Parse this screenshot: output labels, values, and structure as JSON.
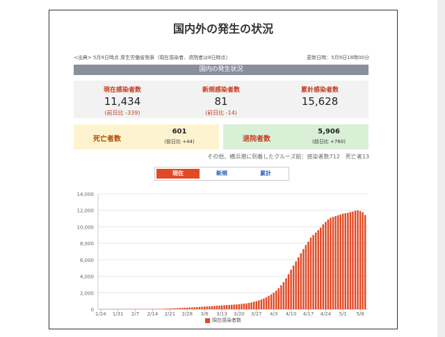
{
  "page": {
    "title": "国内外の発生の状況",
    "source": "<出典> 5月9日時点 厚生労働省発表（現在感染者、退院者は8日時点）",
    "updated": "更新日時：5月9日18時00分",
    "section_header": "国内の発生状況"
  },
  "summary": {
    "current": {
      "label": "現在感染者数",
      "value": "11,434",
      "diff": "(前日比 -339)"
    },
    "new": {
      "label": "新規感染者数",
      "value": "81",
      "diff": "(前日比 -14)"
    },
    "cumulative": {
      "label": "累計感染者数",
      "value": "15,628"
    },
    "deaths": {
      "label": "死亡者数",
      "value": "601",
      "diff": "(前日比 +44)"
    },
    "recovered": {
      "label": "退院者数",
      "value": "5,906",
      "diff": "(前日比 +760)"
    },
    "cruise_note": "その他、横浜港に到着したクルーズ船：感染者数712　死亡者13"
  },
  "tabs": [
    {
      "label": "現在",
      "active": true
    },
    {
      "label": "新規",
      "active": false
    },
    {
      "label": "累計",
      "active": false
    }
  ],
  "colors": {
    "accent": "#e24a26",
    "section_bar": "#8a8f9e",
    "deaths_bg": "#fdf4cf",
    "recovered_bg": "#d9f0d6"
  },
  "chart_data": {
    "type": "bar",
    "start_date": "2020-01-24",
    "x_ticks": [
      "1/24",
      "1/31",
      "2/7",
      "2/14",
      "2/21",
      "2/28",
      "3/6",
      "3/13",
      "3/20",
      "3/27",
      "4/3",
      "4/10",
      "4/17",
      "4/24",
      "5/1",
      "5/8"
    ],
    "ylim": [
      0,
      14000
    ],
    "y_ticks": [
      "0",
      "2,000",
      "4,000",
      "6,000",
      "8,000",
      "10,000",
      "12,000",
      "14,000"
    ],
    "grid": true,
    "legend": "bottom",
    "series": [
      {
        "name": "現在感染者数",
        "color": "#e24a26",
        "values": [
          3,
          4,
          4,
          5,
          8,
          9,
          10,
          12,
          15,
          17,
          18,
          19,
          20,
          21,
          22,
          23,
          24,
          25,
          27,
          29,
          31,
          33,
          36,
          39,
          44,
          54,
          61,
          73,
          87,
          99,
          115,
          130,
          145,
          160,
          175,
          190,
          210,
          225,
          245,
          260,
          275,
          300,
          320,
          340,
          360,
          380,
          400,
          420,
          440,
          460,
          480,
          500,
          520,
          540,
          560,
          585,
          610,
          640,
          675,
          710,
          760,
          830,
          900,
          980,
          1070,
          1180,
          1300,
          1450,
          1620,
          1800,
          2000,
          2250,
          2550,
          2900,
          3300,
          3750,
          4250,
          4800,
          5300,
          5800,
          6300,
          6800,
          7300,
          7800,
          8200,
          8700,
          9000,
          9300,
          9600,
          9900,
          10300,
          10600,
          10900,
          11100,
          11200,
          11300,
          11400,
          11500,
          11600,
          11650,
          11700,
          11800,
          11850,
          11950,
          12000,
          11900,
          11773,
          11434
        ]
      }
    ]
  }
}
